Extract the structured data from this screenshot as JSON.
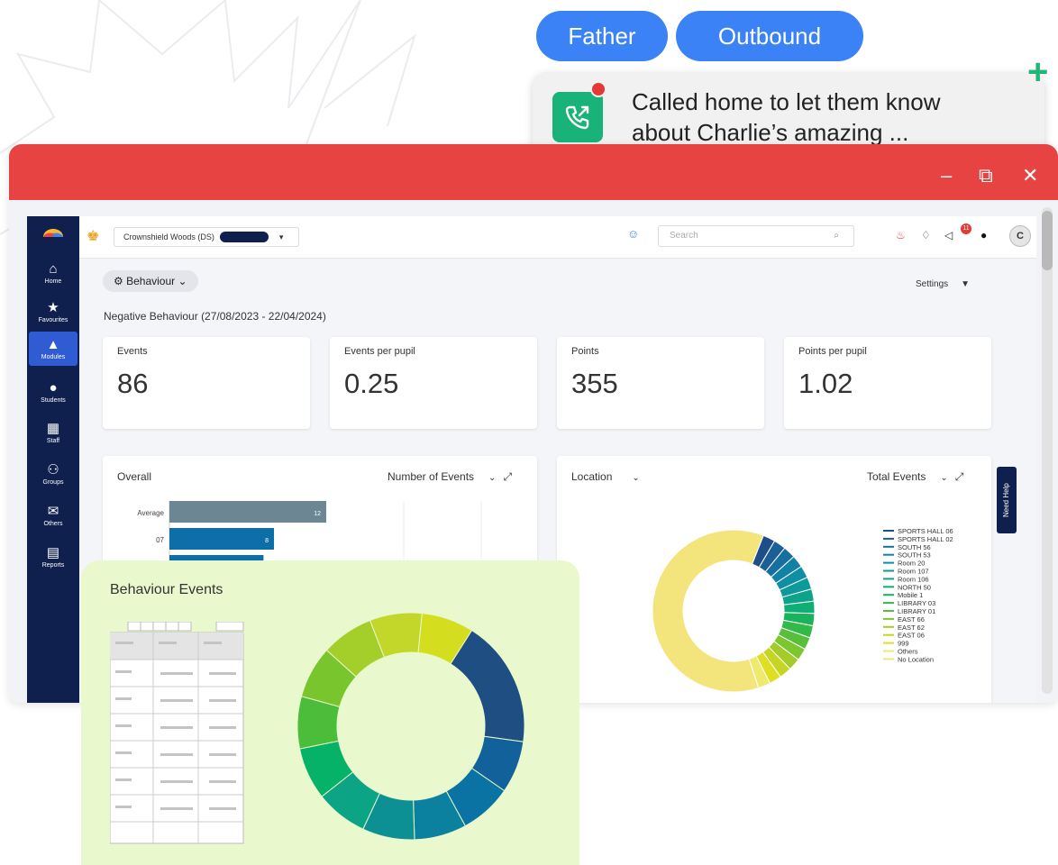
{
  "chips": {
    "relation": "Father",
    "direction": "Outbound"
  },
  "note": {
    "text_line1": "Called home to let them know",
    "text_line2": "about Charlie’s amazing ...",
    "add_icon": "plus-icon",
    "call_icon": "phone-call-icon"
  },
  "window": {
    "minimize": "–",
    "restore": "⧉",
    "close": "✕"
  },
  "sidebar": {
    "items": [
      {
        "label": "Home",
        "icon": "⌂"
      },
      {
        "label": "Favourites",
        "icon": "★"
      },
      {
        "label": "Modules",
        "icon": "▲"
      },
      {
        "label": "Students",
        "icon": "●"
      },
      {
        "label": "Staff",
        "icon": "▦"
      },
      {
        "label": "Groups",
        "icon": "⚇"
      },
      {
        "label": "Others",
        "icon": "✉"
      },
      {
        "label": "Reports",
        "icon": "▤"
      }
    ]
  },
  "topbar": {
    "school": "Crownshield Woods (DS)",
    "search_placeholder": "Search",
    "notification_count": "11",
    "avatar": "C"
  },
  "module": {
    "label": "Behaviour",
    "settings": "Settings"
  },
  "report_title": "Negative Behaviour (27/08/2023 - 22/04/2024)",
  "stats": [
    {
      "label": "Events",
      "value": "86"
    },
    {
      "label": "Events per pupil",
      "value": "0.25"
    },
    {
      "label": "Points",
      "value": "355"
    },
    {
      "label": "Points per pupil",
      "value": "1.02"
    }
  ],
  "overall_panel": {
    "title": "Overall",
    "metric": "Number of Events"
  },
  "location_panel": {
    "title": "Location",
    "metric": "Total Events"
  },
  "need_help": "Need Help",
  "events_card": {
    "title": "Behaviour Events"
  },
  "chart_data": [
    {
      "type": "bar",
      "categories": [
        "Average",
        "07",
        ""
      ],
      "values": [
        12,
        8,
        null
      ]
    },
    {
      "type": "pie",
      "legend_position": "right",
      "categories": [
        "SPORTS HALL 06",
        "SPORTS HALL 02",
        "SOUTH 56",
        "SOUTH 53",
        "Room 20",
        "Room 107",
        "Room 106",
        "NORTH 50",
        "Mobile 1",
        "LIBRARY 03",
        "LIBRARY 01",
        "EAST 66",
        "EAST 62",
        "EAST 06",
        "999",
        "Others",
        "No Location"
      ],
      "values": [
        2,
        2,
        2,
        2,
        2,
        2,
        2,
        2,
        2,
        2,
        2,
        2,
        2,
        2,
        2,
        2,
        50
      ],
      "colors": [
        "#1d4e89",
        "#1b5f96",
        "#176f9f",
        "#1380a6",
        "#0f8ea5",
        "#0d9a9b",
        "#0ca38a",
        "#0fae74",
        "#19b35c",
        "#33b84a",
        "#57bf3a",
        "#7cc62f",
        "#a3cc28",
        "#c6d523",
        "#dede22",
        "#eeea70",
        "#f3e57c"
      ]
    },
    {
      "type": "pie",
      "values": [
        22,
        9,
        9,
        9,
        9,
        9,
        9,
        9,
        9,
        9,
        9,
        9
      ],
      "colors": [
        "#1f4e82",
        "#12619a",
        "#0b72a4",
        "#0b809f",
        "#0d9093",
        "#0ba585",
        "#06b268",
        "#4bbd3b",
        "#79c52d",
        "#a4cf2a",
        "#c2d72a",
        "#d4de1e"
      ]
    }
  ]
}
